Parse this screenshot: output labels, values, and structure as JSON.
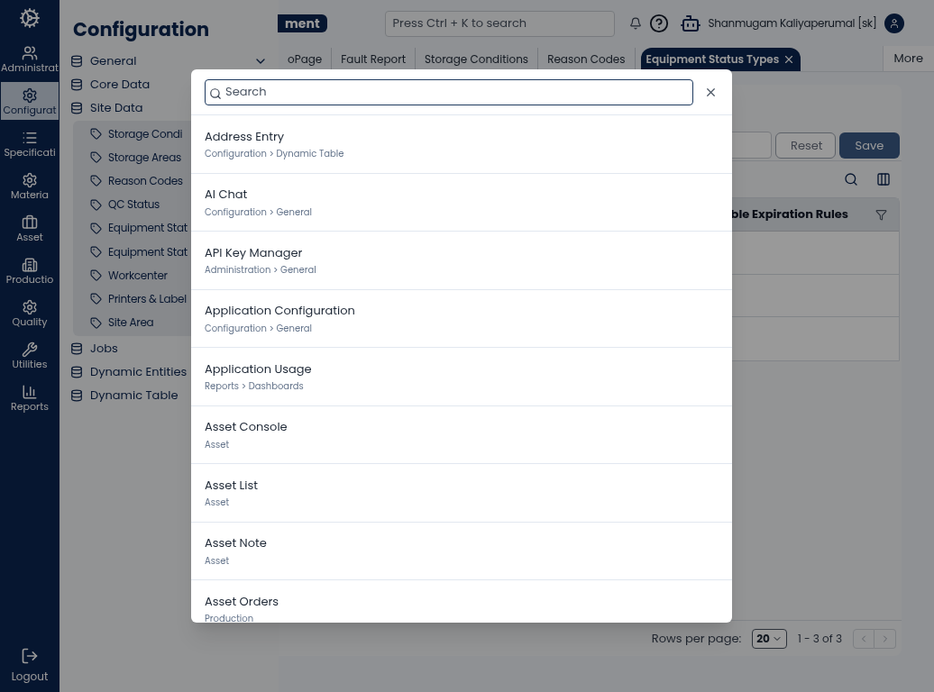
{
  "nav": {
    "items": [
      {
        "label": "Administrat",
        "selected": false
      },
      {
        "label": "Configurat",
        "selected": true
      },
      {
        "label": "Specificati",
        "selected": false
      },
      {
        "label": "Materia",
        "selected": false
      },
      {
        "label": "Asset",
        "selected": false
      },
      {
        "label": "Productio",
        "selected": false
      },
      {
        "label": "Quality",
        "selected": false
      },
      {
        "label": "Utilities",
        "selected": false
      },
      {
        "label": "Reports",
        "selected": false
      }
    ],
    "logout": "Logout"
  },
  "config_panel": {
    "title": "Configuration",
    "collapse_toggle": true,
    "items": [
      {
        "label": "General"
      },
      {
        "label": "Core Data"
      },
      {
        "label": "Site Data",
        "children": [
          {
            "label": "Storage Condi"
          },
          {
            "label": "Storage Areas"
          },
          {
            "label": "Reason Codes"
          },
          {
            "label": "QC Status"
          },
          {
            "label": "Equipment Stat"
          },
          {
            "label": "Equipment Stat"
          },
          {
            "label": "Workcenter"
          },
          {
            "label": "Printers & Label"
          },
          {
            "label": "Site Area"
          }
        ]
      },
      {
        "label": "Jobs"
      },
      {
        "label": "Dynamic Entities"
      },
      {
        "label": "Dynamic Table"
      }
    ]
  },
  "header": {
    "badge": "ment",
    "search": {
      "placeholder": "Press Ctrl + K to search"
    },
    "user": "Shanmugam Kaliyaperumal [sk]"
  },
  "tabs": [
    {
      "label": "oPage",
      "selected": false,
      "closable": false
    },
    {
      "label": "Fault Report",
      "selected": false,
      "closable": false
    },
    {
      "label": "Storage Conditions",
      "selected": false,
      "closable": false
    },
    {
      "label": "Reason Codes",
      "selected": false,
      "closable": false
    },
    {
      "label": "Equipment Status Types",
      "selected": true,
      "closable": true
    }
  ],
  "more": "More",
  "toolbar": {
    "buttons": [
      "Reset",
      "Save"
    ]
  },
  "table": {
    "column": "ble Expiration Rules"
  },
  "pagination": {
    "label": "Rows per page:",
    "value": "20",
    "range": "1 - 3 of 3"
  },
  "dialog": {
    "search": {
      "placeholder": "Search"
    },
    "results": [
      {
        "title": "Address Entry",
        "path": "Configuration > Dynamic Table"
      },
      {
        "title": "AI Chat",
        "path": "Configuration > General"
      },
      {
        "title": "API Key Manager",
        "path": "Administration > General"
      },
      {
        "title": "Application Configuration",
        "path": "Configuration > General"
      },
      {
        "title": "Application Usage",
        "path": "Reports > Dashboards"
      },
      {
        "title": "Asset Console",
        "path": "Asset"
      },
      {
        "title": "Asset List",
        "path": "Asset"
      },
      {
        "title": "Asset Note",
        "path": "Asset"
      },
      {
        "title": "Asset Orders",
        "path": "Production"
      }
    ]
  }
}
